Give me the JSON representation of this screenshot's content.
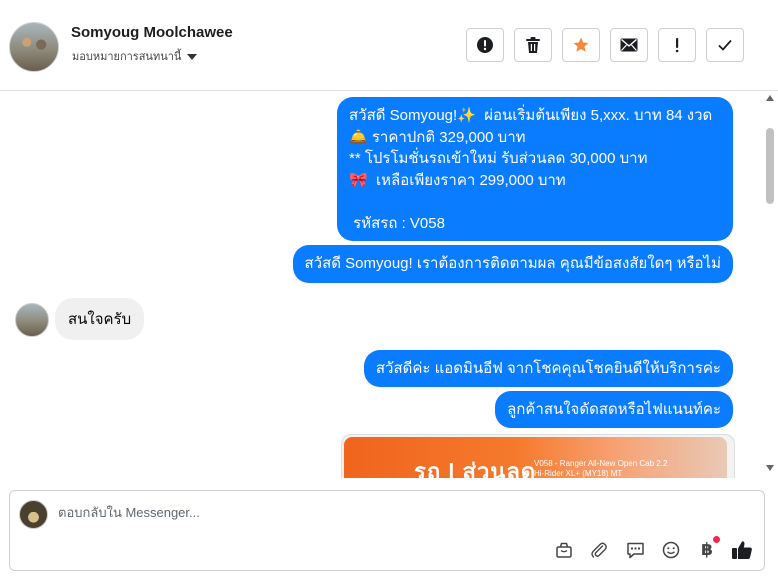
{
  "header": {
    "contact_name": "Somyoug Moolchawee",
    "assignment_label": "มอบหมายการสนทนานี้",
    "actions": [
      {
        "name": "report-spam-icon",
        "icon": "exclamation-circle"
      },
      {
        "name": "delete-icon",
        "icon": "trash"
      },
      {
        "name": "star-icon",
        "icon": "star",
        "color": "#f5883a"
      },
      {
        "name": "mail-icon",
        "icon": "envelope"
      },
      {
        "name": "mark-important-icon",
        "icon": "exclamation"
      },
      {
        "name": "mark-done-icon",
        "icon": "check"
      }
    ]
  },
  "messages": {
    "promo": "สวัสดี Somyoug!✨  ผ่อนเริ่มต้นเพียง 5,xxx. บาท 84 งวด\n🛎️ ราคาปกติ 329,000 บาท\n** โปรโมชั่นรถเข้าใหม่ รับส่วนลด 30,000 บาท\n🎀  เหลือเพียงราคา 299,000 บาท\n\n รหัสรถ : V058",
    "followup": "สวัสดี Somyoug! เราต้องการติดตามผล คุณมีข้อสงสัยใดๆ หรือไม่",
    "customer_reply": "สนใจครับ",
    "admin_greeting": "สวัสดีค่ะ แอดมินอีฟ จากโชคคุณโชคยินดีให้บริการค่ะ",
    "admin_question": "ลูกค้าสนใจดัดสดหรือไฟแนนท์คะ",
    "image_banner_big": "รถ | ส่วนลด",
    "image_banner_small": "V058 - Ranger All-New Open Cab 2.2\nHi-Rider XL+ (MY18) MT"
  },
  "composer": {
    "placeholder": "ตอบกลับใน Messenger...",
    "icons": [
      "bag-icon",
      "paperclip-icon",
      "saved-reply-icon",
      "emoji-icon",
      "currency-icon",
      "like-icon"
    ],
    "currency_symbol": "฿"
  },
  "colors": {
    "outgoing_bubble": "#0a7cff",
    "incoming_bubble": "#f0f0f0",
    "notification_dot": "#f02849"
  }
}
